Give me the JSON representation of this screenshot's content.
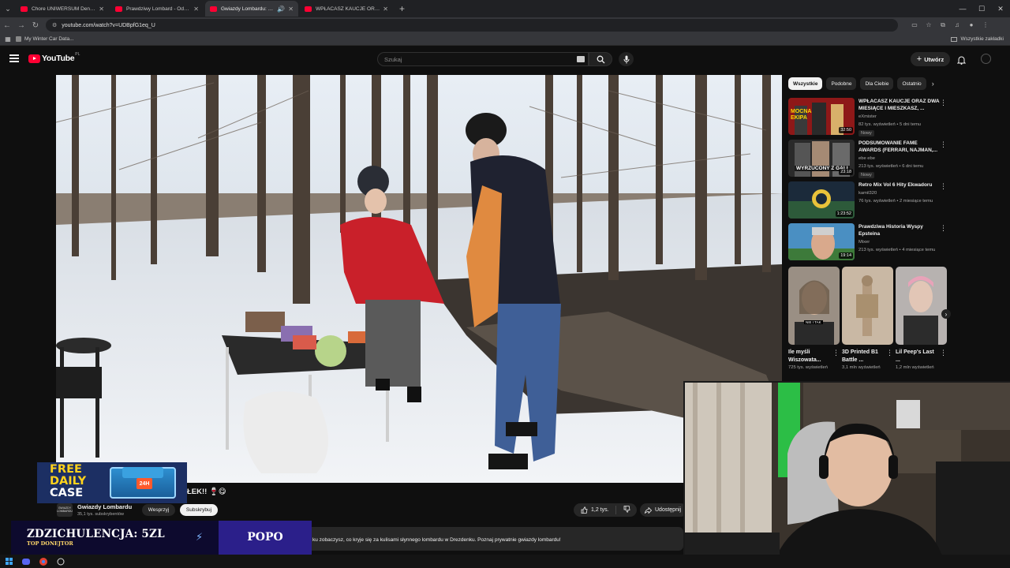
{
  "browser": {
    "tabs": [
      {
        "label": "Chore UNIWERSUM Deniłsa Zał",
        "active": false
      },
      {
        "label": "Prawdziwy Lombard - Odcinek",
        "active": false
      },
      {
        "label": "Gwiazdy Lombardu: Gotuje",
        "active": true
      },
      {
        "label": "WPŁACASZ KAUCJE ORAZ DWA",
        "active": false
      }
    ],
    "url": "youtube.com/watch?v=UDBpfG1eq_U",
    "bookmark": "My Winter Car Data...",
    "all_bookmarks": "Wszystkie zakładki"
  },
  "youtube": {
    "logo_text": "YouTube",
    "country": "PL",
    "search_placeholder": "Szukaj",
    "create_label": "Utwórz"
  },
  "video": {
    "title_visible_part": "ŁEK!! 🍷😋",
    "channel_name": "Gwiazdy Lombardu",
    "channel_avatar_text": "GWIAZDY LOMBARDU",
    "subscribers": "35,1 tys. subskrybentów",
    "support_label": "Wesprzyj",
    "subscribe_label": "Subskrybuj",
    "likes": "1,2 tys.",
    "share_label": "Udostępnij",
    "description": "ku zobaczysz, co kryje się za kulisami słynnego lombardu w Drezdenku. Poznaj prywatnie gwiazdy lombardu!"
  },
  "sidebar": {
    "chips": [
      {
        "label": "Wszystkie",
        "active": true
      },
      {
        "label": "Podobne",
        "active": false
      },
      {
        "label": "Dla Ciebie",
        "active": false
      },
      {
        "label": "Ostatnio",
        "active": false
      }
    ],
    "recommendations": [
      {
        "title": "WPŁACASZ KAUCJE ORAZ DWA MIESIĄCE I MIESZKASZ, ...",
        "channel": "eXmister",
        "meta": "82 tys. wyświetleń • 5 dni temu",
        "badge": "Nowy",
        "duration": "32:50",
        "thumb_text": "MOCNA EKIPA"
      },
      {
        "title": "PODSUMOWANIE FAME AWARDS (FERRARI, NAJMAN,...",
        "channel": "ebe ebe",
        "meta": "213 tys. wyświetleń • 6 dni temu",
        "badge": "Nowy",
        "duration": "23:18",
        "thumb_text": "WYRZUCONY Z GALI"
      },
      {
        "title": "Retro Mix Vol 6 Hity Ekwadoru",
        "channel": "kamil320",
        "meta": "76 tys. wyświetleń • 2 miesiące temu",
        "badge": "",
        "duration": "1:23:52",
        "thumb_text": ""
      },
      {
        "title": "Prawdziwa Historia Wyspy Epsteina",
        "channel": "Mixer",
        "meta": "213 tys. wyświetleń • 4 miesiące temu",
        "badge": "",
        "duration": "19:14",
        "thumb_text": ""
      }
    ],
    "shorts": [
      {
        "title": "Ile myśli Wiszowata...",
        "views": "725 tys. wyświetleń",
        "thumb_text": "NIE I TAK"
      },
      {
        "title": "3D Printed B1 Battle ...",
        "views": "3,1 mln wyświetleń",
        "thumb_text": ""
      },
      {
        "title": "Lil Peep's Last ...",
        "views": "1,2 mln wyświetleń",
        "thumb_text": ""
      }
    ]
  },
  "overlays": {
    "free_case": {
      "line1": "FREE",
      "line2": "DAILY",
      "line3": "CASE",
      "badge": "24H"
    },
    "donate": {
      "main": "ZDZICHULENCJA: 5ZL",
      "sub": "TOP DONEJTOR",
      "name": "POPO"
    }
  },
  "colors": {
    "yt_red": "#ff0033",
    "accent_blue": "#3ea6ff",
    "page_bg": "#0f0f0f"
  }
}
